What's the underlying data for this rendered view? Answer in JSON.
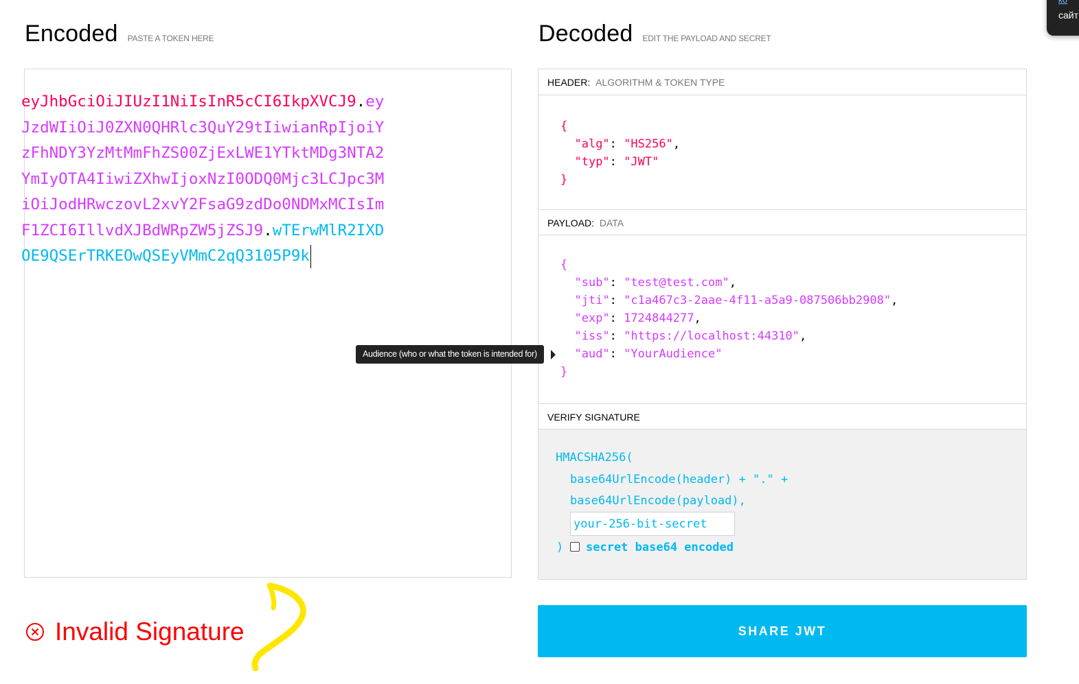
{
  "encoded": {
    "title": "Encoded",
    "subtitle": "PASTE A TOKEN HERE",
    "token_lines": [
      [
        {
          "part": "p1",
          "text": "eyJhbGciOiJIUzI1NiIsInR5cCI6IkpXVCJ9"
        },
        {
          "part": "dot",
          "text": "."
        },
        {
          "part": "p2",
          "text": "ey"
        }
      ],
      [
        {
          "part": "p2",
          "text": "JzdWIiOiJ0ZXN0QHRlc3QuY29tIiwianRpIjoiY"
        }
      ],
      [
        {
          "part": "p2",
          "text": "zFhNDY3YzMtMmFhZS00ZjExLWE1YTktMDg3NTA2"
        }
      ],
      [
        {
          "part": "p2",
          "text": "YmIyOTA4IiwiZXhwIjoxNzI0ODQ0Mjc3LCJpc3M"
        }
      ],
      [
        {
          "part": "p2",
          "text": "iOiJodHRwczovL2xvY2FsaG9zdDo0NDMxMCIsIm"
        }
      ],
      [
        {
          "part": "p2",
          "text": "F1ZCI6IllvdXJBdWRpZW5jZSJ9"
        },
        {
          "part": "dot",
          "text": "."
        },
        {
          "part": "p3",
          "text": "wTErwMlR2IXD"
        }
      ],
      [
        {
          "part": "p3",
          "text": "OE9QSErTRKEOwQSEyVMmC2qQ3105P9k"
        }
      ]
    ]
  },
  "decoded": {
    "title": "Decoded",
    "subtitle": "EDIT THE PAYLOAD AND SECRET",
    "header_section": {
      "label": "HEADER:",
      "sub": "ALGORITHM & TOKEN TYPE"
    },
    "payload_section": {
      "label": "PAYLOAD:",
      "sub": "DATA"
    },
    "verify_section": {
      "label": "VERIFY SIGNATURE"
    },
    "header_json": [
      {
        "k": "alg",
        "v": "\"HS256\"",
        "comma": true
      },
      {
        "k": "typ",
        "v": "\"JWT\"",
        "comma": false
      }
    ],
    "payload_json": [
      {
        "k": "sub",
        "v": "\"test@test.com\"",
        "comma": true
      },
      {
        "k": "jti",
        "v": "\"c1a467c3-2aae-4f11-a5a9-087506bb2908\"",
        "comma": true
      },
      {
        "k": "exp",
        "v": "1724844277",
        "comma": true
      },
      {
        "k": "iss",
        "v": "\"https://localhost:44310\"",
        "comma": true
      },
      {
        "k": "aud",
        "v": "\"YourAudience\"",
        "comma": false
      }
    ],
    "verify": {
      "line1": "HMACSHA256(",
      "line2": "base64UrlEncode(header) + \".\" +",
      "line3": "base64UrlEncode(payload),",
      "secret_placeholder": "your-256-bit-secret",
      "close": ")",
      "checkbox_label": "secret base64 encoded"
    }
  },
  "status": {
    "text": "Invalid Signature",
    "color": "#fb0000"
  },
  "share_button": "SHARE JWT",
  "tooltip": "Audience (who or what the token is intended for)",
  "corner_popup": {
    "link": "ко",
    "text": "сайт"
  },
  "colors": {
    "header": "#fb015b",
    "payload": "#d63aff",
    "signature": "#00b9f1",
    "accent": "#00b9f1"
  }
}
